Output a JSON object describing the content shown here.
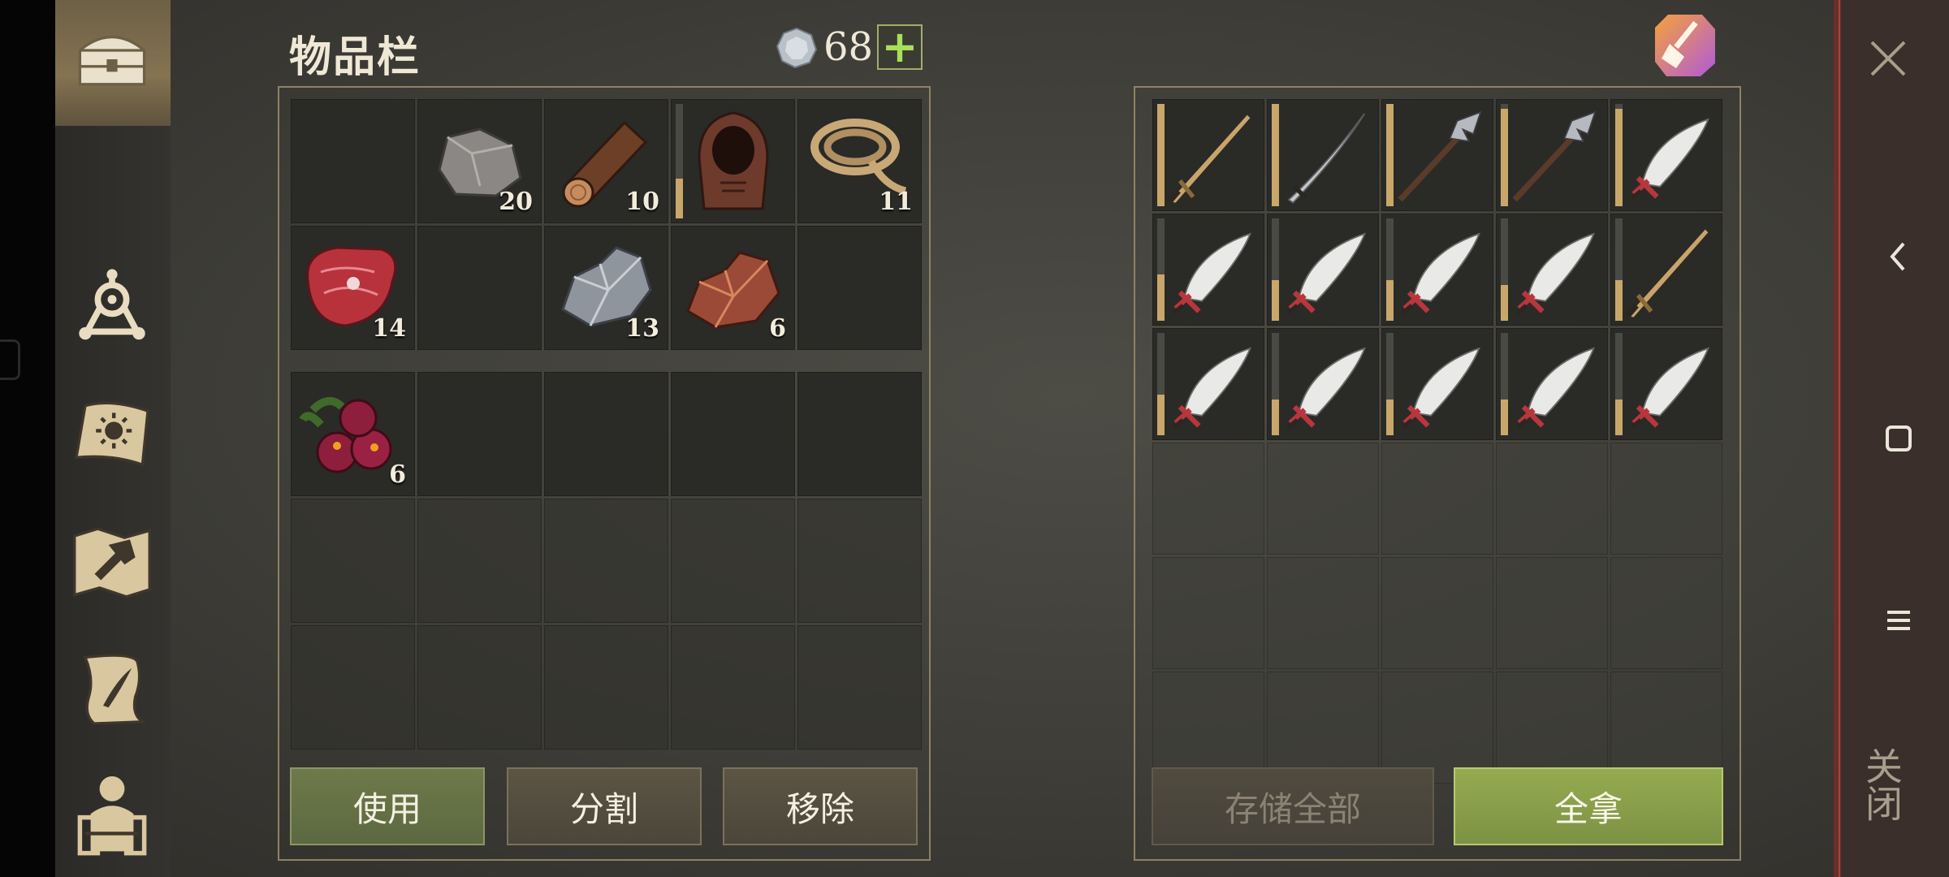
{
  "window": {
    "title": "物品栏"
  },
  "currency": {
    "icon": "silver-coin-icon",
    "amount": "68",
    "add_icon": "plus-icon"
  },
  "sidebar": {
    "items": [
      {
        "name": "chest-icon",
        "active": true
      },
      {
        "name": "skills-icon",
        "active": false
      },
      {
        "name": "journal-icon",
        "active": false
      },
      {
        "name": "crafting-map-icon",
        "active": false
      },
      {
        "name": "quest-scroll-icon",
        "active": false
      },
      {
        "name": "character-icon",
        "active": false
      }
    ]
  },
  "inventory": {
    "top_slots": [
      {
        "item": null,
        "qty": ""
      },
      {
        "item": "stone-icon",
        "qty": "20"
      },
      {
        "item": "wood-log-icon",
        "qty": "10"
      },
      {
        "item": "hood-icon",
        "qty": "",
        "durability": 0.35
      },
      {
        "item": "rope-icon",
        "qty": "11"
      },
      {
        "item": "raw-meat-icon",
        "qty": "14"
      },
      {
        "item": null,
        "qty": ""
      },
      {
        "item": "iron-ore-icon",
        "qty": "13"
      },
      {
        "item": "copper-ore-icon",
        "qty": "6"
      },
      {
        "item": null,
        "qty": ""
      }
    ],
    "bottom_slots": [
      {
        "item": "berries-icon",
        "qty": "6"
      },
      {
        "item": null,
        "qty": ""
      },
      {
        "item": null,
        "qty": ""
      },
      {
        "item": null,
        "qty": ""
      },
      {
        "item": null,
        "qty": ""
      }
    ],
    "actions": {
      "use": "使用",
      "split": "分割",
      "remove": "移除"
    }
  },
  "storage": {
    "slots": [
      {
        "item": "sword-icon",
        "durability": 1.0
      },
      {
        "item": "katana-icon",
        "durability": 1.0
      },
      {
        "item": "halberd-icon",
        "durability": 1.0
      },
      {
        "item": "halberd-icon",
        "durability": 0.95
      },
      {
        "item": "scimitar-icon",
        "durability": 0.95
      },
      {
        "item": "scimitar-icon",
        "durability": 0.45
      },
      {
        "item": "scimitar-icon",
        "durability": 0.4
      },
      {
        "item": "scimitar-icon",
        "durability": 0.4
      },
      {
        "item": "scimitar-icon",
        "durability": 0.35
      },
      {
        "item": "sword-icon",
        "durability": 0.4
      },
      {
        "item": "scimitar-icon",
        "durability": 0.4
      },
      {
        "item": "scimitar-icon",
        "durability": 0.35
      },
      {
        "item": "scimitar-icon",
        "durability": 0.35
      },
      {
        "item": "scimitar-icon",
        "durability": 0.35
      },
      {
        "item": "scimitar-icon",
        "durability": 0.35
      }
    ],
    "empty_rows": 3,
    "actions": {
      "store_all": "存储全部",
      "take_all": "全拿"
    },
    "clean_icon": "broom-icon"
  },
  "system": {
    "close_label": "关闭",
    "close_icon": "close-icon",
    "back_icon": "back-icon",
    "home_icon": "home-icon",
    "menu_icon": "menu-icon"
  },
  "colors": {
    "accent_green": "#95ab50",
    "durability": "#c9a76a",
    "close_strip": "#6a2f2a"
  }
}
